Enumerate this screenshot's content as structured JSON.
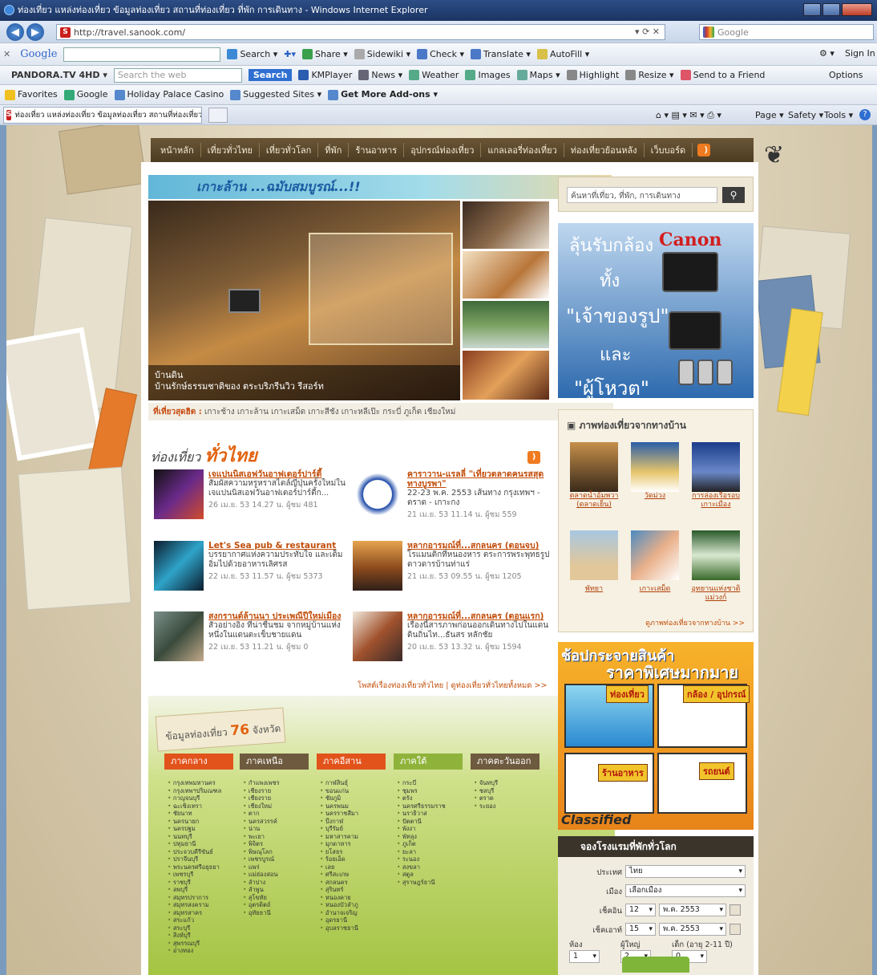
{
  "window": {
    "title": "ท่องเที่ยว แหล่งท่องเที่ยว ข้อมูลท่องเที่ยว สถานที่ท่องเที่ยว ที่พัก การเดินทาง - Windows Internet Explorer"
  },
  "address": {
    "url": "http://travel.sanook.com/",
    "search_placeholder": "Google"
  },
  "google_toolbar": {
    "logo": "Google",
    "search": "Search",
    "share": "Share",
    "sidewiki": "Sidewiki",
    "check": "Check",
    "translate": "Translate",
    "autofill": "AutoFill",
    "signin": "Sign In"
  },
  "pandora_toolbar": {
    "logo": "PANDORA.TV",
    "brand_suffix": "4HD",
    "search_placeholder": "Search the web",
    "search_button": "Search",
    "items": [
      "KMPlayer",
      "News",
      "Weather",
      "Images",
      "Maps",
      "Highlight",
      "Resize",
      "Send to a Friend"
    ],
    "options": "Options"
  },
  "favorites_bar": {
    "favorites": "Favorites",
    "items": [
      "Google",
      "Holiday Palace Casino",
      "Suggested Sites",
      "Get More Add-ons"
    ]
  },
  "tab_bar": {
    "tab_title": "ท่องเที่ยว แหล่งท่องเที่ยว ข้อมูลท่องเที่ยว สถานที่ท่องเที่ยว...",
    "commands": [
      "Page",
      "Safety",
      "Tools"
    ]
  },
  "site_nav": [
    "หน้าหลัก",
    "เที่ยวทั่วไทย",
    "เที่ยวทั่วโลก",
    "ที่พัก",
    "ร้านอาหาร",
    "อุปกรณ์ท่องเที่ยว",
    "แกลเลอรี่ท่องเที่ยว",
    "ท่องเที่ยวย้อนหลัง",
    "เว็บบอร์ด"
  ],
  "hero": {
    "title": "เกาะล้าน ...ฉมับสมบูรณ์...!!",
    "caption_title": "บ้านดิน",
    "caption_sub": "บ้านรักษ์ธรรมชาติของ ตระบริภรีนวิว รีสอร์ท"
  },
  "hot_tags": {
    "label": "ที่เที่ยวสุดฮิต :",
    "tags": "เกาะช้าง เกาะล้าน เกาะเสม็ด เกาะสีชัง เกาะหลีเป๊ะ กระบี่ ภูเก็ต เชียงใหม่"
  },
  "section": {
    "title_pre": "ท่องเที่ยว",
    "title_main": "ทั่วไทย"
  },
  "news": [
    {
      "headline": "เจแปนนิสเอฟวันอาฟเตอร์ปาร์ตี้",
      "desc": "สัมผัสความหรูหราสไตล์ญี่ปุ่นครั้งใหม่ในเจแปนนิสเอฟวันอาฟเตอร์ปาร์ตี้ก...",
      "meta": "26 เม.ย. 53 14.27 น. ผู้ชม 481"
    },
    {
      "headline": "คาราวาน-แรลลี่ \"เที่ยวตลาดคนรสสุดทางบูรพา\"",
      "desc": "22-23 พ.ค. 2553 เส้นทาง กรุงเทพฯ - ตราด - เกาะกง",
      "meta": "21 เม.ย. 53 11.14 น. ผู้ชม 559"
    },
    {
      "headline": "Let's Sea pub & restaurant",
      "desc": "บรรยากาศแห่งความประทับใจ และเต็มอิ่มไปด้วยอาหารเลิศรส",
      "meta": "22 เม.ย. 53 11.57 น. ผู้ชม 5373"
    },
    {
      "headline": "หลากอารมณ์ที่...สกลนคร (ตอนจบ)",
      "desc": "โรแมนติกที่หนองหาร ตระการพระพุทธรูปดาวดารบ้านท่าแร่",
      "meta": "21 เม.ย. 53 09.55 น. ผู้ชม 1205"
    },
    {
      "headline": "สงกรานต์ล้านนา ประเพณีปีใหม่เมือง",
      "desc": "สัวอย่างอิง ที่น่าชื่นชม จากหมู่บ้านแห่งหนึ่งในแดนตะเข็บชายแดน",
      "meta": "22 เม.ย. 53 11.21 น. ผู้ชม 0"
    },
    {
      "headline": "หลากอารมณ์ที่...สกลนคร (ตอนแรก)",
      "desc": "เรื่องนี้สารภาพก่อนออกเดินทางไปในแดนดินถิ่นไท...ธันสร หลักชัย",
      "meta": "20 เม.ย. 53 13.32 น. ผู้ชม 1594"
    }
  ],
  "more_links": "โพสต์เรื่องท่องเที่ยวทั่วไทย | ดูท่องเที่ยวทั่วไทยทั้งหมด >>",
  "provinces": {
    "title_pre": "ข้อมูลท่องเที่ยว",
    "count": "76",
    "title_post": "จังหวัด",
    "regions": [
      {
        "name": "ภาคกลาง",
        "color": "#e2531c",
        "items": [
          "กรุงเทพมหานคร",
          "กรุงเทพฯปริมณฑล",
          "กาญจนบุรี",
          "ฉะเชิงเทรา",
          "ชัยนาท",
          "นครนายก",
          "นครปฐม",
          "นนทบุรี",
          "ปทุมธานี",
          "ประจวบคีรีขันธ์",
          "ปราจีนบุรี",
          "พระนครศรีอยุธยา",
          "เพชรบุรี",
          "ราชบุรี",
          "ลพบุรี",
          "สมุทรปราการ",
          "สมุทรสงคราม",
          "สมุทรสาคร",
          "สระแก้ว",
          "สระบุรี",
          "สิงห์บุรี",
          "สุพรรณบุรี",
          "อ่างทอง"
        ]
      },
      {
        "name": "ภาคเหนือ",
        "color": "#6e5a3e",
        "items": [
          "กำแพงเพชร",
          "เชียงราย",
          "เชียงราย",
          "เชียงใหม่",
          "ตาก",
          "นครสวรรค์",
          "น่าน",
          "พะเยา",
          "พิจิตร",
          "พิษณุโลก",
          "เพชรบูรณ์",
          "แพร่",
          "แม่ฮ่องสอน",
          "ลำปาง",
          "ลำพูน",
          "สุโขทัย",
          "อุตรดิตถ์",
          "อุทัยธานี"
        ]
      },
      {
        "name": "ภาคอีสาน",
        "color": "#e2531c",
        "items": [
          "กาฬสินธุ์",
          "ขอนแก่น",
          "ชัยภูมิ",
          "นครพนม",
          "นครราชสีมา",
          "บึงกาฬ",
          "บุรีรัมย์",
          "มหาสารคาม",
          "มุกดาหาร",
          "ยโสธร",
          "ร้อยเอ็ด",
          "เลย",
          "ศรีสะเกษ",
          "สกลนคร",
          "สุรินทร์",
          "หนองคาย",
          "หนองบัวลำภู",
          "อำนาจเจริญ",
          "อุดรธานี",
          "อุบลราชธานี"
        ]
      },
      {
        "name": "ภาคใต้",
        "color": "#8fb33a",
        "items": [
          "กระบี่",
          "ชุมพร",
          "ตรัง",
          "นครศรีธรรมราช",
          "นราธิวาส",
          "ปัตตานี",
          "พังงา",
          "พัทลุง",
          "ภูเก็ต",
          "ยะลา",
          "ระนอง",
          "สงขลา",
          "สตูล",
          "สุราษฎร์ธานี"
        ]
      },
      {
        "name": "ภาคตะวันออก",
        "color": "#6e5a3e",
        "items": [
          "จันทบุรี",
          "ชลบุรี",
          "ตราด",
          "ระยอง"
        ]
      }
    ]
  },
  "side_search": {
    "placeholder": "ค้นหาที่เที่ยว, ที่พัก, การเดินทาง"
  },
  "ad": {
    "line1": "ลุ้นรับกล้อง",
    "brand": "Canon",
    "line2": "ทั้ง",
    "line3": "\"เจ้าของรูป\"",
    "line4": "และ",
    "line5": "\"ผู้โหวต\""
  },
  "photos": {
    "title": "ภาพท่องเที่ยวจากทางบ้าน",
    "items": [
      "ตลาดน้ำอัมพวา (ตลาดเย็น)",
      "วัดม่วง",
      "การล่องเรือรอบเกาะเมือง",
      "พัทยา",
      "เกาะเสม็ด",
      "อุทยานแห่งชาติแม่วงก์"
    ],
    "more": "ดูภาพท่องเที่ยวจากทางบ้าน >>"
  },
  "classified": {
    "title": "ช้อปกระจายสินค้า",
    "subtitle": "ราคาพิเศษมากมาย",
    "labels": [
      "ท่องเที่ยว",
      "กล้อง / อุปกรณ์",
      "ร้านอาหาร",
      "รถยนต์"
    ],
    "brand": "Classified"
  },
  "hotel": {
    "title": "จองโรงแรมที่พักทั่วโลก",
    "country_label": "ประเทศ",
    "country": "ไทย",
    "city_label": "เมือง",
    "city": "เลือกเมือง",
    "checkin_label": "เช็คอิน",
    "checkin_day": "12",
    "checkin_month": "พ.ค. 2553",
    "checkout_label": "เช็คเอาท์",
    "checkout_day": "15",
    "checkout_month": "พ.ค. 2553",
    "rooms_label": "ห้อง",
    "rooms": "1",
    "adults_label": "ผู้ใหญ่",
    "adults": "2",
    "kids_label": "เด็ก (อายุ 2-11 ปี)",
    "kids": "0"
  }
}
